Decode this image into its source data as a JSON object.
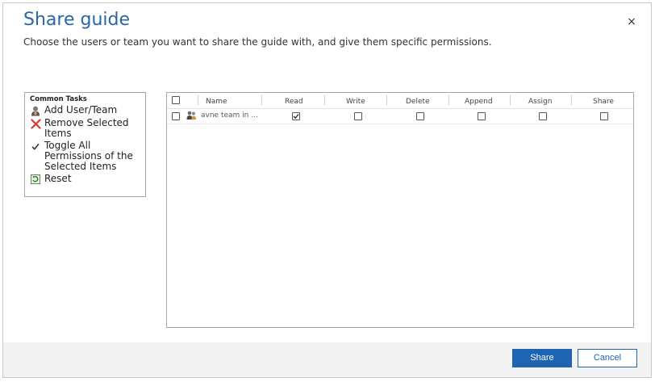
{
  "dialog": {
    "title": "Share guide",
    "subtitle": "Choose the users or team you want to share the guide with, and give them specific permissions.",
    "close_glyph": "×"
  },
  "tasks": {
    "header": "Common Tasks",
    "items": [
      {
        "label": "Add User/Team",
        "icon": "user-icon"
      },
      {
        "label": "Remove Selected Items",
        "icon": "red-x-icon"
      },
      {
        "label": "Toggle All Permissions of the Selected Items",
        "icon": "checkmark-icon"
      },
      {
        "label": "Reset",
        "icon": "reset-icon"
      }
    ]
  },
  "grid": {
    "columns": [
      "Name",
      "Read",
      "Write",
      "Delete",
      "Append",
      "Assign",
      "Share"
    ],
    "rows": [
      {
        "name": "avne team in ...",
        "read": true,
        "write": false,
        "delete": false,
        "append": false,
        "assign": false,
        "share": false
      }
    ]
  },
  "footer": {
    "share_label": "Share",
    "cancel_label": "Cancel"
  },
  "colors": {
    "title": "#2b66a8",
    "primary_button": "#1f63b3",
    "footer_bg": "#f3f3f3",
    "remove_icon": "#d23b2c"
  }
}
